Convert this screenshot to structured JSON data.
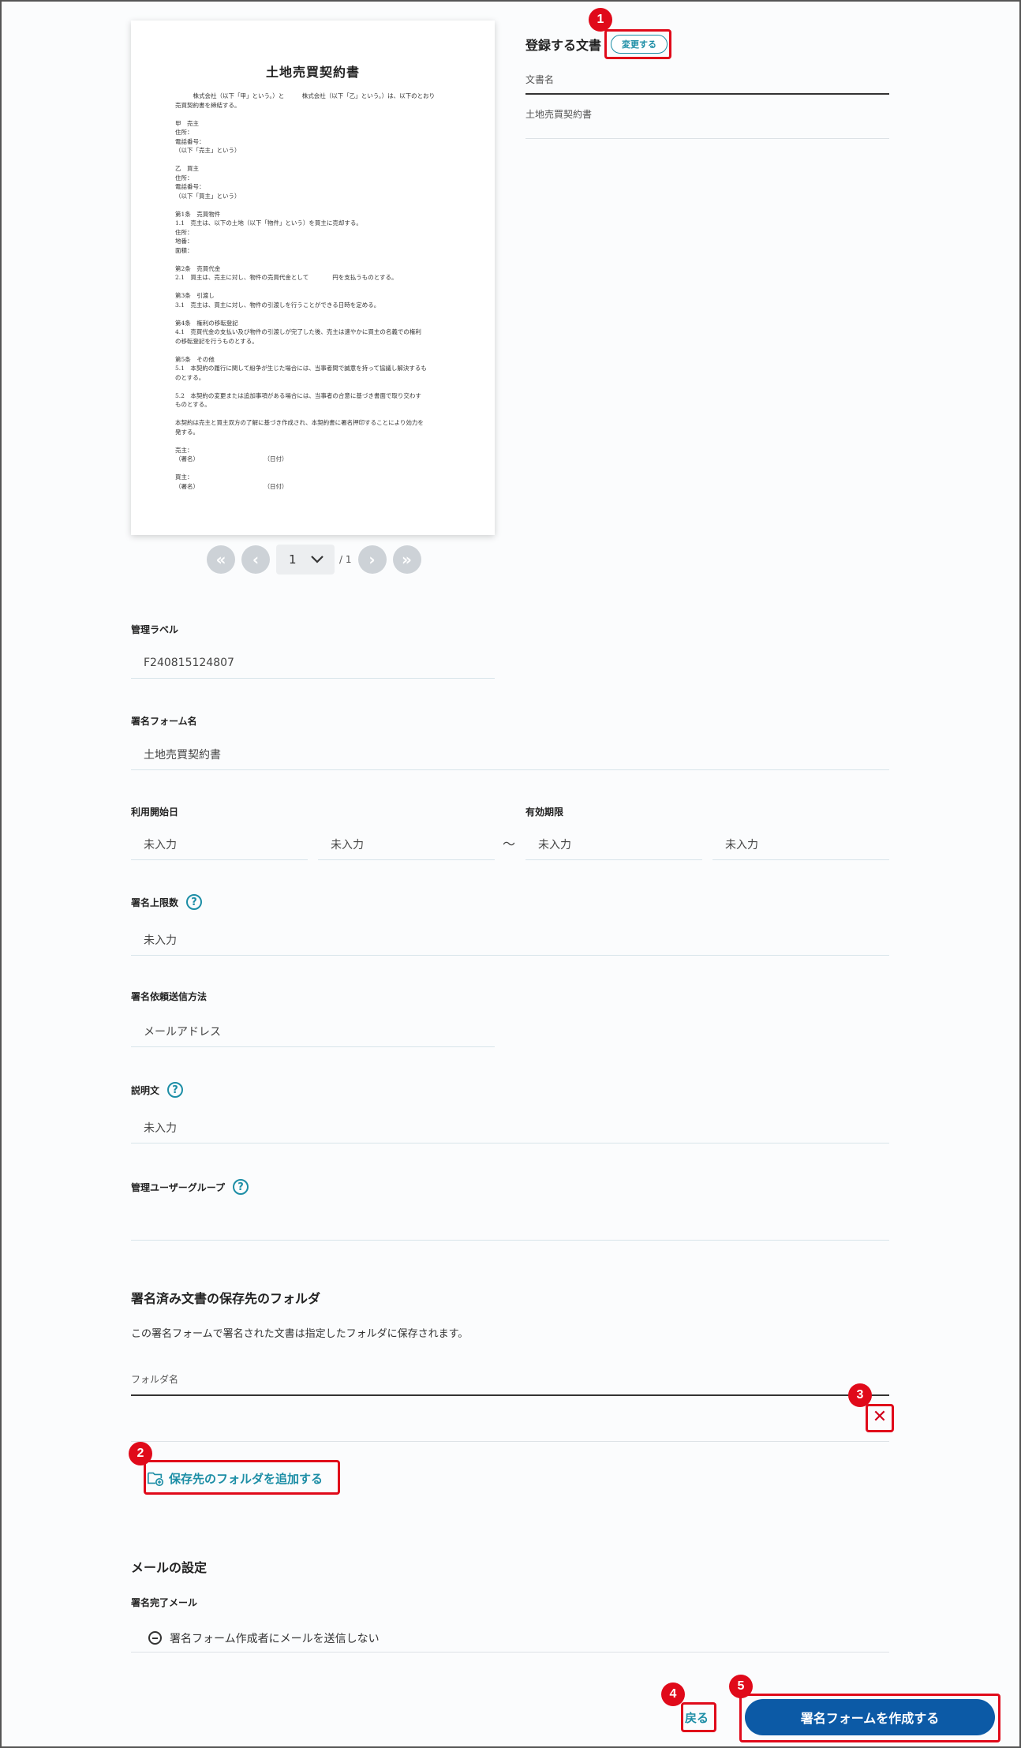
{
  "document": {
    "title": "土地売買契約書",
    "lines": [
      "　　　株式会社（以下「甲」という。）と　　　株式会社（以下「乙」という。）は、以下のとおり",
      "売買契約書を締結する。",
      "",
      "甲　売主",
      "住所：",
      "電話番号：",
      "（以下「売主」という）",
      "",
      "乙　買主",
      "住所：",
      "電話番号：",
      "（以下「買主」という）",
      "",
      "第1条　売買物件",
      "1.1　売主は、以下の土地（以下「物件」という）を買主に売却する。",
      "住所：",
      "地番：",
      "面積：",
      "",
      "第2条　売買代金",
      "2.1　買主は、売主に対し、物件の売買代金として　　　　円を支払うものとする。",
      "",
      "第3条　引渡し",
      "3.1　売主は、買主に対し、物件の引渡しを行うことができる日時を定める。",
      "",
      "第4条　権利の移転登記",
      "4.1　売買代金の支払い及び物件の引渡しが完了した後、売主は速やかに買主の名義での権利",
      "の移転登記を行うものとする。",
      "",
      "第5条　その他",
      "5.1　本契約の履行に関して紛争が生じた場合には、当事者間で誠意を持って協議し解決するも",
      "のとする。",
      "",
      "5.2　本契約の変更または追加事項がある場合には、当事者の合意に基づき書面で取り交わす",
      "ものとする。",
      "",
      "本契約は売主と買主双方の了解に基づき作成され、本契約書に署名押印することにより効力を",
      "発する。",
      "",
      "売主：",
      "（署名）　　　　　　　　　　　　（日付）",
      "",
      "買主：",
      "（署名）　　　　　　　　　　　　（日付）"
    ]
  },
  "pager": {
    "current": "1",
    "total": "/ 1",
    "first_icon": "double-chevron-left-icon",
    "prev_icon": "chevron-left-icon",
    "next_icon": "chevron-right-icon",
    "last_icon": "double-chevron-right-icon"
  },
  "registered_doc": {
    "title": "登録する文書",
    "change_label": "変更する",
    "column_header": "文書名",
    "file_name": "土地売買契約書"
  },
  "form": {
    "management_label": {
      "label": "管理ラベル",
      "value": "F240815124807"
    },
    "form_name": {
      "label": "署名フォーム名",
      "value": "土地売買契約書"
    },
    "start_date": {
      "label": "利用開始日",
      "date": "未入力",
      "time": "未入力"
    },
    "separator": "～",
    "expiry": {
      "label": "有効期限",
      "date": "未入力",
      "time": "未入力"
    },
    "sign_limit": {
      "label": "署名上限数",
      "value": "未入力"
    },
    "send_method": {
      "label": "署名依頼送信方法",
      "value": "メールアドレス"
    },
    "description": {
      "label": "説明文",
      "value": "未入力"
    },
    "admin_group": {
      "label": "管理ユーザーグループ",
      "value": ""
    },
    "help_glyph": "?"
  },
  "folder": {
    "section_title": "署名済み文書の保存先のフォルダ",
    "description": "この署名フォームで署名された文書は指定したフォルダに保存されます。",
    "column_header": "フォルダ名",
    "clear_glyph": "✕",
    "add_label": "保存先のフォルダを追加する"
  },
  "mail": {
    "section_title": "メールの設定",
    "completion_label": "署名完了メール",
    "completion_value": "署名フォーム作成者にメールを送信しない"
  },
  "footer": {
    "back_label": "戻る",
    "create_label": "署名フォームを作成する"
  },
  "annotations": [
    "1",
    "2",
    "3",
    "4",
    "5"
  ],
  "colors": {
    "accent": "#1d8ea6",
    "primary": "#0c5aa6",
    "annotation": "#e00a1a"
  }
}
